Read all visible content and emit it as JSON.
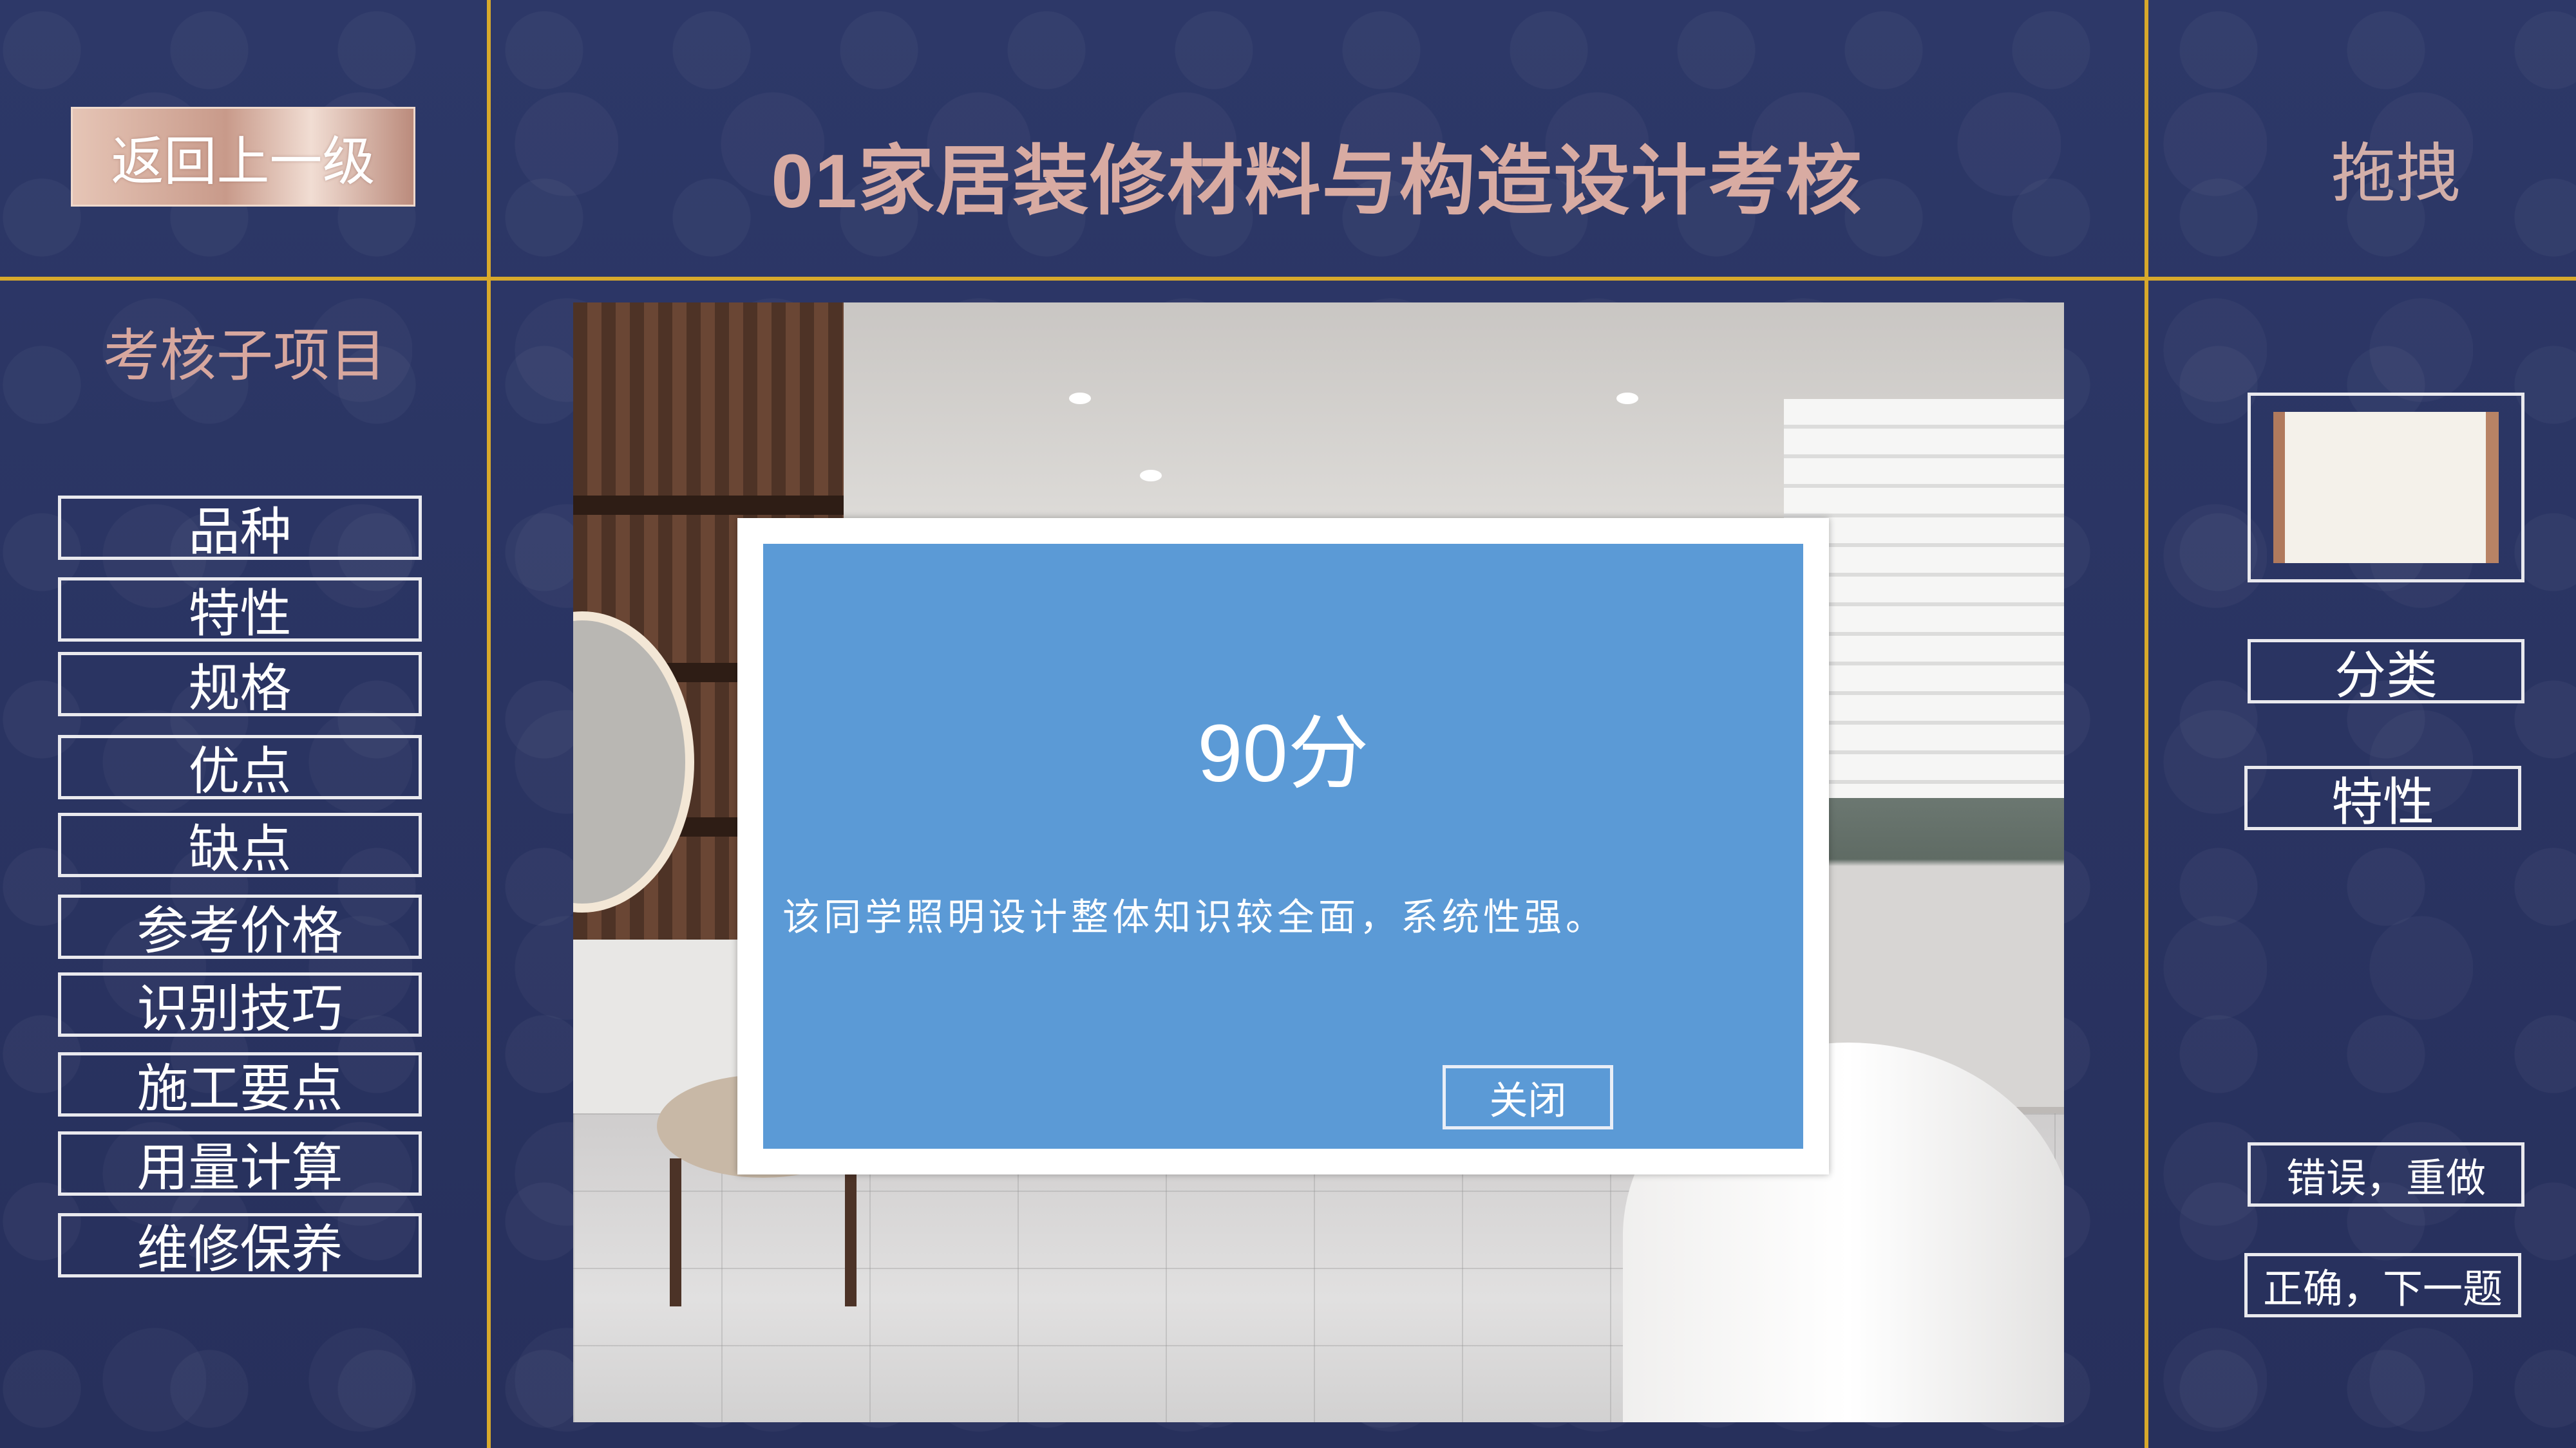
{
  "header": {
    "back_label": "返回上一级",
    "title": "01家居装修材料与构造设计考核",
    "drag_label": "拖拽"
  },
  "sidebar": {
    "title": "考核子项目",
    "items": [
      {
        "label": "品种"
      },
      {
        "label": "特性"
      },
      {
        "label": "规格"
      },
      {
        "label": "优点"
      },
      {
        "label": "缺点"
      },
      {
        "label": "参考价格"
      },
      {
        "label": "识别技巧"
      },
      {
        "label": "施工要点"
      },
      {
        "label": "用量计算"
      },
      {
        "label": "维修保养"
      }
    ]
  },
  "dialog": {
    "score": "90分",
    "comment": "该同学照明设计整体知识较全面，系统性强。",
    "close_label": "关闭"
  },
  "right_panel": {
    "classify_label": "分类",
    "property_label": "特性",
    "wrong_label": "错误，重做",
    "correct_label": "正确，下一题"
  },
  "colors": {
    "background": "#2b3564",
    "gold_lines": "#d8a92b",
    "title_text": "#d8aba2",
    "dialog_blue": "#5b9ad6"
  }
}
